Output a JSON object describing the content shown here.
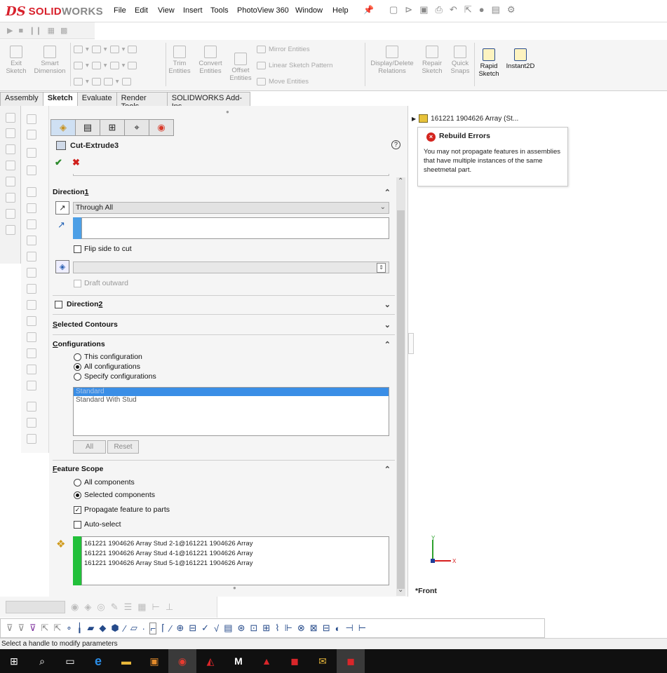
{
  "app": {
    "logo_ds": "DS",
    "logo_solid": "SOLID",
    "logo_works": "WORKS"
  },
  "menu": [
    "File",
    "Edit",
    "View",
    "Insert",
    "Tools",
    "PhotoView 360",
    "Window",
    "Help"
  ],
  "ribbon": {
    "exit_sketch": "Exit\nSketch",
    "smart_dimension": "Smart\nDimension",
    "trim_entities": "Trim\nEntities",
    "convert_entities": "Convert\nEntities",
    "offset_entities": "Offset\nEntities",
    "mirror_entities": "Mirror Entities",
    "linear_sketch_pattern": "Linear Sketch Pattern",
    "move_entities": "Move Entities",
    "display_delete_relations": "Display/Delete\nRelations",
    "repair_sketch": "Repair\nSketch",
    "quick_snaps": "Quick\nSnaps",
    "rapid_sketch": "Rapid\nSketch",
    "instant2d": "Instant2D"
  },
  "tabs": [
    "Assembly",
    "Sketch",
    "Evaluate",
    "Render Tools",
    "SOLIDWORKS Add-Ins"
  ],
  "active_tab": "Sketch",
  "feature": {
    "title": "Cut-Extrude3",
    "help": "?",
    "ok": "✔",
    "cancel": "✖"
  },
  "direction1": {
    "header_prefix": "Direction ",
    "header_num": "1",
    "end_condition": "Through All",
    "flip_side": "Flip side to cut",
    "draft_outward": "Draft outward"
  },
  "direction2": {
    "header_prefix": "Direction ",
    "header_num": "2"
  },
  "selected_contours": {
    "first": "S",
    "rest": "elected Contours"
  },
  "configurations": {
    "first": "C",
    "rest": "onfigurations",
    "options": [
      "This configuration",
      "All configurations",
      "Specify configurations"
    ],
    "selected_option": "All configurations",
    "list": [
      "Standard",
      "Standard With Stud"
    ],
    "selected_item": "Standard",
    "all_btn": "All",
    "reset_btn": "Reset"
  },
  "feature_scope": {
    "first": "F",
    "rest": "eature Scope",
    "options": [
      "All components",
      "Selected components"
    ],
    "selected_option": "Selected components",
    "propagate": "Propagate feature to parts",
    "propagate_checked": true,
    "auto_select": "Auto-select",
    "components": [
      "161221 1904626 Array Stud 2-1@161221 1904626 Array",
      "161221 1904626 Array Stud 4-1@161221 1904626 Array",
      "161221 1904626 Array Stud 5-1@161221 1904626 Array"
    ]
  },
  "viewport": {
    "tree_item": "161221 1904626 Array  (St...",
    "error_title": "Rebuild Errors",
    "error_msg": "You may not propagate features in assemblies that have multiple instances of the same sheetmetal part.",
    "axis_y": "Y",
    "axis_x": "X",
    "view_label": "*Front"
  },
  "status_bar": "Select a handle to modify parameters",
  "colors": {
    "brand_red": "#d8212c",
    "error_red": "#d4251f",
    "selection_blue": "#3a8ee6",
    "component_green": "#22c03a"
  }
}
